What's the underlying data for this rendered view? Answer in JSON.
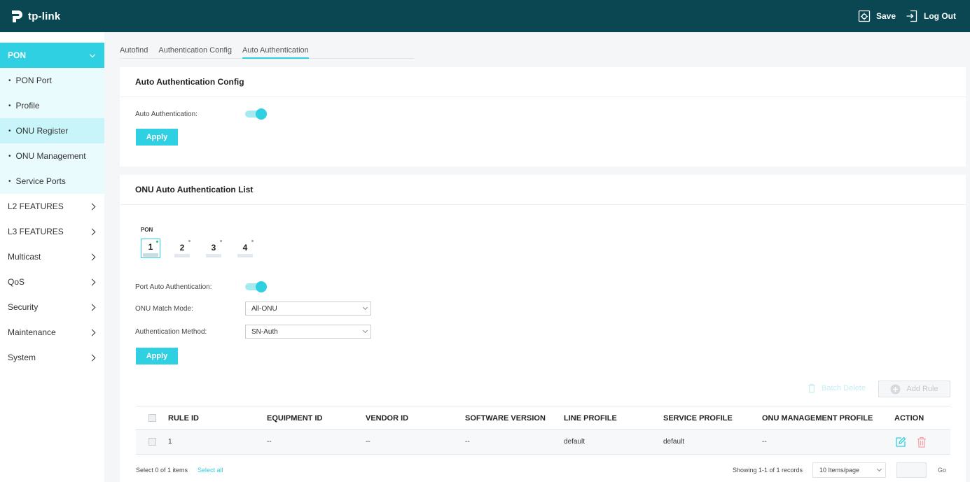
{
  "header": {
    "logo_text": "tp-link",
    "save_label": "Save",
    "logout_label": "Log Out"
  },
  "sidebar": {
    "section": "PON",
    "sub_items": [
      {
        "label": "PON Port"
      },
      {
        "label": "Profile"
      },
      {
        "label": "ONU Register",
        "active": true
      },
      {
        "label": "ONU Management"
      },
      {
        "label": "Service Ports"
      }
    ],
    "items": [
      {
        "label": "L2 FEATURES"
      },
      {
        "label": "L3 FEATURES"
      },
      {
        "label": "Multicast"
      },
      {
        "label": "QoS"
      },
      {
        "label": "Security"
      },
      {
        "label": "Maintenance"
      },
      {
        "label": "System"
      }
    ]
  },
  "tabs": [
    {
      "label": "Autofind"
    },
    {
      "label": "Authentication Config"
    },
    {
      "label": "Auto Authentication",
      "active": true
    }
  ],
  "config_card": {
    "title": "Auto Authentication Config",
    "auto_auth_label": "Auto Authentication:",
    "auto_auth_enabled": true,
    "apply_label": "Apply"
  },
  "list_card": {
    "title": "ONU Auto Authentication List",
    "pon_label": "PON",
    "ports": [
      "1",
      "2",
      "3",
      "4"
    ],
    "selected_port": "1",
    "port_auto_auth_label": "Port Auto Authentication:",
    "port_auto_auth_enabled": true,
    "match_mode_label": "ONU Match Mode:",
    "match_mode_value": "All-ONU",
    "auth_method_label": "Authentication Method:",
    "auth_method_value": "SN-Auth",
    "apply_label": "Apply",
    "batch_delete_label": "Batch Delete",
    "add_rule_label": "Add Rule"
  },
  "table": {
    "columns": [
      "RULE ID",
      "EQUIPMENT ID",
      "VENDOR ID",
      "SOFTWARE VERSION",
      "LINE PROFILE",
      "SERVICE PROFILE",
      "ONU MANAGEMENT PROFILE",
      "ACTION"
    ],
    "rows": [
      [
        "1",
        "--",
        "--",
        "--",
        "default",
        "default",
        "--"
      ]
    ]
  },
  "footer": {
    "select_count": "Select 0 of 1 items",
    "select_all": "Select all",
    "records": "Showing 1-1 of 1 records",
    "per_page": "10 Items/page",
    "go_label": "Go"
  },
  "colors": {
    "topbar": "#0b4653",
    "accent": "#2ed0e1"
  }
}
